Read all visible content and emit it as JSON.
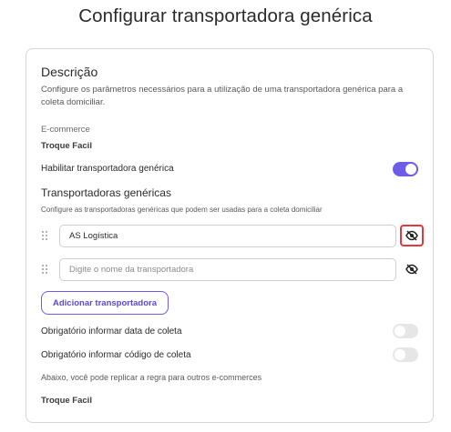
{
  "page": {
    "title": "Configurar transportadora genérica"
  },
  "description": {
    "title": "Descrição",
    "text": "Configure os parâmetros necessários para a utilização de uma transportadora genérica para a coleta domiciliar."
  },
  "ecommerce": {
    "label": "E-commerce",
    "value": "Troque Facil"
  },
  "enable_generic": {
    "label": "Habilitar transportadora genérica",
    "on": true
  },
  "generic_carriers": {
    "title": "Transportadoras genéricas",
    "text": "Configure as transportadoras genéricas que podem ser usadas para a coleta domiciliar",
    "items": [
      {
        "value": "AS Logística",
        "placeholder": "",
        "eye_icon": "eye-off-icon",
        "highlighted": true
      },
      {
        "value": "",
        "placeholder": "Digite o nome da transportadora",
        "eye_icon": "eye-off-icon",
        "highlighted": false
      }
    ],
    "add_button_label": "Adicionar transportadora"
  },
  "required_pickup_date": {
    "label": "Obrigatório informar data de coleta",
    "on": false
  },
  "required_pickup_code": {
    "label": "Obrigatório informar código de coleta",
    "on": false
  },
  "replicate": {
    "text": "Abaixo, você pode replicar a regra para outros e-commerces",
    "value": "Troque Facil"
  },
  "colors": {
    "accent": "#6c5ce7",
    "highlight_border": "#e0393e",
    "toggle_off": "#e6e6e6"
  }
}
